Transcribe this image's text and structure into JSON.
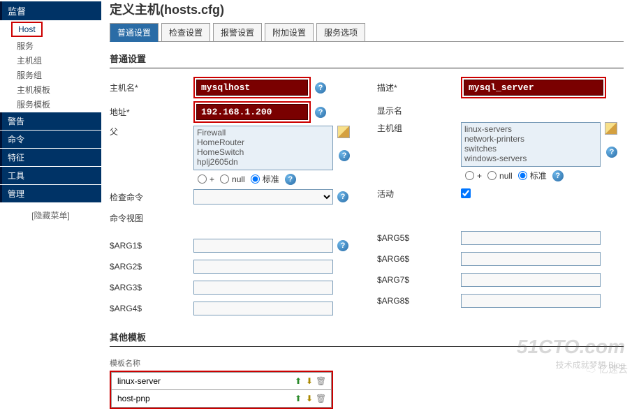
{
  "sidebar": {
    "header": "监督",
    "host_item": "Host",
    "items": [
      "服务",
      "主机组",
      "服务组",
      "主机模板",
      "服务模板"
    ],
    "sections": [
      "警告",
      "命令",
      "特征",
      "工具",
      "管理"
    ],
    "hide_menu": "[隐藏菜单]"
  },
  "page_title": "定义主机(hosts.cfg)",
  "tabs": [
    "普通设置",
    "检查设置",
    "报警设置",
    "附加设置",
    "服务选项"
  ],
  "section_basic": "普通设置",
  "labels": {
    "hostname": "主机名*",
    "address": "地址*",
    "parent": "父",
    "check_command": "检查命令",
    "command_view": "命令视图",
    "description": "描述*",
    "display_name": "显示名",
    "hostgroup": "主机组",
    "active": "活动",
    "arg1": "$ARG1$",
    "arg2": "$ARG2$",
    "arg3": "$ARG3$",
    "arg4": "$ARG4$",
    "arg5": "$ARG5$",
    "arg6": "$ARG6$",
    "arg7": "$ARG7$",
    "arg8": "$ARG8$"
  },
  "values": {
    "hostname": "mysqlhost",
    "address": "192.168.1.200",
    "description": "mysql_server"
  },
  "parent_options": [
    "Firewall",
    "HomeRouter",
    "HomeSwitch",
    "hplj2605dn"
  ],
  "hostgroup_options": [
    "linux-servers",
    "network-printers",
    "switches",
    "windows-servers"
  ],
  "radio": {
    "plus": "+",
    "null": "null",
    "standard": "标准"
  },
  "section_templates": "其他模板",
  "template_header": "模板名称",
  "templates": [
    "linux-server",
    "host-pnp"
  ],
  "watermarks": {
    "w1": "51CTO.com",
    "w2": "技术成就梦想   Blog",
    "w3": "☁ 亿速云"
  }
}
